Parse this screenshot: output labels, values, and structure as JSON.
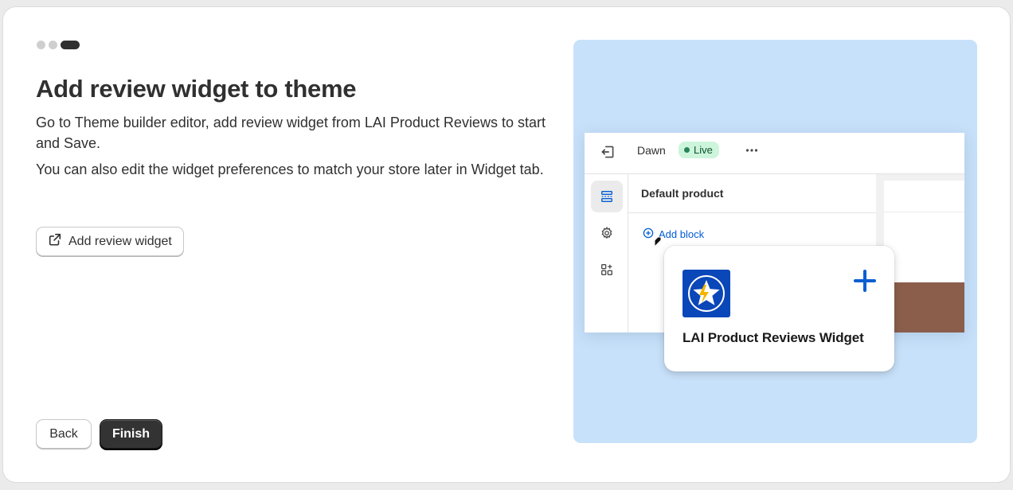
{
  "stepper": {
    "total": 3,
    "current": 3
  },
  "heading": "Add review widget to theme",
  "description": [
    "Go to Theme builder editor, add review widget from LAI Product Reviews to start and Save.",
    "You can also edit the widget preferences to match your store later in Widget tab."
  ],
  "actions": {
    "add_widget_label": "Add review widget",
    "back_label": "Back",
    "finish_label": "Finish"
  },
  "illustration": {
    "store_name": "Dawn",
    "status_badge": "Live",
    "panel_title": "Default product",
    "add_block_label": "Add block",
    "app_name": "LAI Product Reviews Widget",
    "icons": [
      "exit-icon",
      "more-horizontal-icon",
      "sections-icon",
      "settings-gear-icon",
      "apps-icon",
      "plus-circle-icon",
      "plus-icon",
      "lai-star-logo"
    ]
  },
  "colors": {
    "primary": "#303030",
    "illustration_bg": "#c8e1fa",
    "link_blue": "#005bd3",
    "live_badge_bg": "#cdf5dc",
    "logo_blue": "#0a47b8"
  }
}
